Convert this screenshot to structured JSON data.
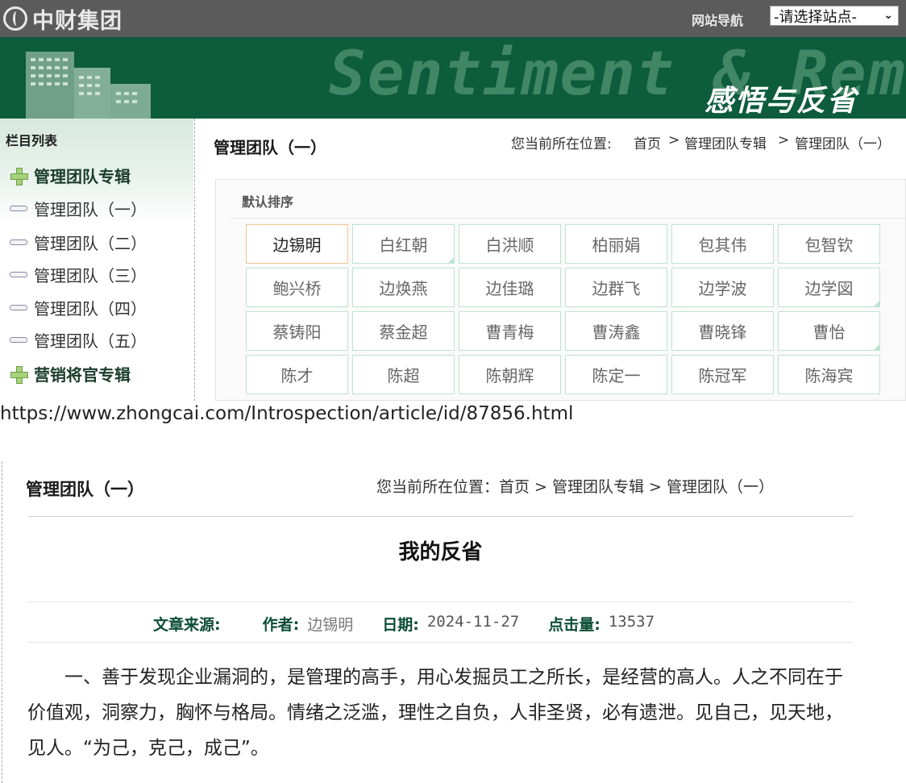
{
  "header": {
    "logo_text": "中财集团",
    "nav_label": "网站导航",
    "site_select_value": "-请选择站点-"
  },
  "banner": {
    "english": "Sentiment & Remorse",
    "chinese": "感悟与反省"
  },
  "sidebar": {
    "title": "栏目列表",
    "items": [
      {
        "label": "管理团队专辑",
        "kind": "group"
      },
      {
        "label": "管理团队（一）",
        "kind": "sub"
      },
      {
        "label": "管理团队（二）",
        "kind": "sub"
      },
      {
        "label": "管理团队（三）",
        "kind": "sub"
      },
      {
        "label": "管理团队（四）",
        "kind": "sub"
      },
      {
        "label": "管理团队（五）",
        "kind": "sub"
      },
      {
        "label": "营销将官专辑",
        "kind": "group"
      }
    ]
  },
  "panel": {
    "title": "管理团队（一）",
    "breadcrumb_prefix": "您当前所在位置:",
    "breadcrumb": [
      "首页",
      ">",
      "管理团队专辑",
      ">",
      "管理团队（一）"
    ],
    "sort_label": "默认排序",
    "names": [
      [
        "边锡明",
        "白红朝",
        "白洪顺",
        "柏丽娟",
        "包其伟",
        "包智钦"
      ],
      [
        "鲍兴桥",
        "边焕燕",
        "边佳璐",
        "边群飞",
        "边学波",
        "边学図"
      ],
      [
        "蔡铸阳",
        "蔡金超",
        "曹青梅",
        "曹涛鑫",
        "曹晓锋",
        "曹怡"
      ],
      [
        "陈才",
        "陈超",
        "陈朝辉",
        "陈定一",
        "陈冠军",
        "陈海宾"
      ]
    ]
  },
  "url": "https://www.zhongcai.com/Introspection/article/id/87856.html",
  "article": {
    "section_title": "管理团队（一）",
    "breadcrumb": "您当前所在位置：首页 > 管理团队专辑 > 管理团队（一）",
    "headline": "我的反省",
    "meta": {
      "source_label": "文章来源:",
      "source_value": "",
      "author_label": "作者:",
      "author_value": "边锡明",
      "date_label": "日期:",
      "date_value": "2024-11-27",
      "hits_label": "点击量:",
      "hits_value": "13537"
    },
    "body": "一、善于发现企业漏洞的，是管理的高手，用心发掘员工之所长，是经营的高人。人之不同在于价值观，洞察力，胸怀与格局。情绪之泛滥，理性之自负，人非圣贤，必有遗泄。见自己，见天地，见人。“为己，克己，成己”。"
  }
}
